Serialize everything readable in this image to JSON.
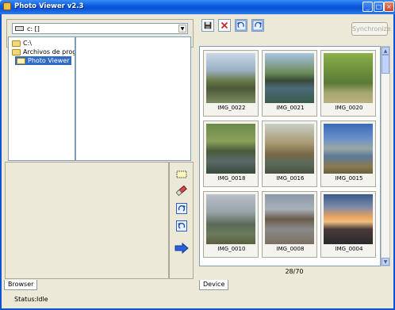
{
  "window": {
    "title": "Photo Viewer v2.3"
  },
  "browser": {
    "drive": "c: []",
    "tree": [
      "C:\\",
      "Archivos de prograr",
      "Photo Viewer"
    ],
    "tab_label": "Browser"
  },
  "device": {
    "sync_label": "Synchronize",
    "tab_label": "Device",
    "counter": "28/70",
    "thumbnails": [
      "IMG_0022",
      "IMG_0021",
      "IMG_0020",
      "IMG_0018",
      "IMG_0016",
      "IMG_0015",
      "IMG_0010",
      "IMG_0008",
      "IMG_0004"
    ]
  },
  "status": {
    "label": "Status:",
    "value": "Idle"
  },
  "colors": {
    "title_bar": "#0a54d4",
    "selection": "#316ac5"
  }
}
